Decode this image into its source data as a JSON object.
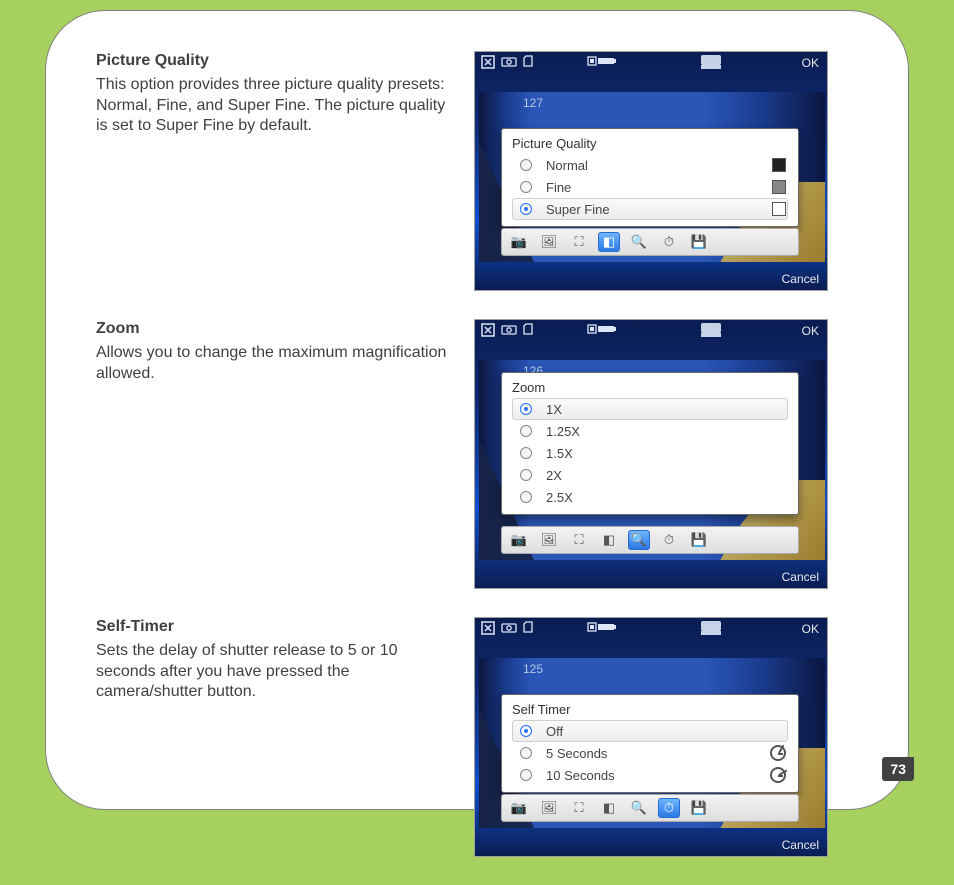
{
  "page_number": "73",
  "sections": [
    {
      "heading": "Picture Quality",
      "body": "This option provides three picture quality presets: Normal, Fine, and Super Fine. The picture quality is set to Super Fine by default.",
      "screenshot": {
        "ok_label": "OK",
        "counter": "127",
        "cancel_label": "Cancel",
        "popup_title": "Picture Quality",
        "options": [
          {
            "label": "Normal",
            "selected": false,
            "icon": "dark"
          },
          {
            "label": "Fine",
            "selected": false,
            "icon": "mid"
          },
          {
            "label": "Super Fine",
            "selected": true,
            "icon": "light"
          }
        ],
        "toolbar_active_index": 3
      }
    },
    {
      "heading": "Zoom",
      "body": "Allows you to change the maximum magnification allowed.",
      "screenshot": {
        "ok_label": "OK",
        "counter": "126",
        "cancel_label": "Cancel",
        "popup_title": "Zoom",
        "options": [
          {
            "label": "1X",
            "selected": true
          },
          {
            "label": "1.25X",
            "selected": false
          },
          {
            "label": "1.5X",
            "selected": false
          },
          {
            "label": "2X",
            "selected": false
          },
          {
            "label": "2.5X",
            "selected": false
          }
        ],
        "toolbar_active_index": 4
      }
    },
    {
      "heading": "Self-Timer",
      "body": "Sets the delay of shutter release to 5 or 10 seconds after you have pressed the camera/shutter button.",
      "screenshot": {
        "ok_label": "OK",
        "counter": "125",
        "cancel_label": "Cancel",
        "popup_title": "Self Timer",
        "options": [
          {
            "label": "Off",
            "selected": true,
            "icon": null
          },
          {
            "label": "5 Seconds",
            "selected": false,
            "icon": "sec5"
          },
          {
            "label": "10 Seconds",
            "selected": false,
            "icon": "sec10"
          }
        ],
        "toolbar_active_index": 5
      }
    }
  ]
}
